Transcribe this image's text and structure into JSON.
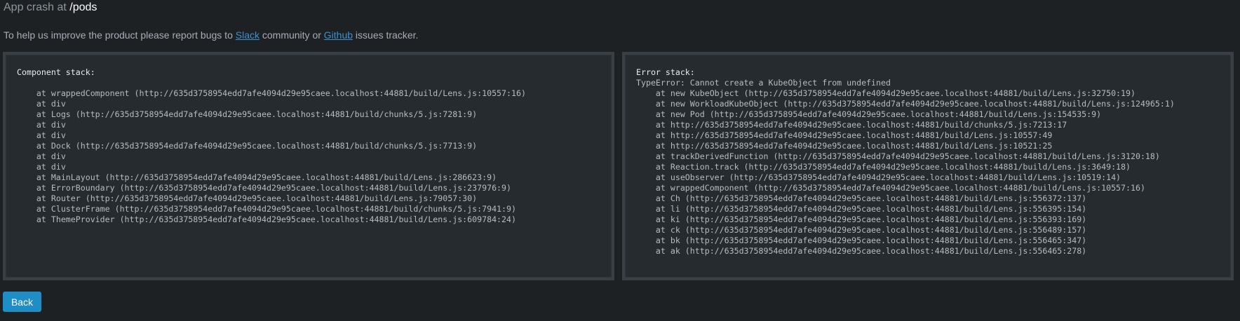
{
  "header": {
    "prefix": "App crash at ",
    "path": "/pods"
  },
  "intro": {
    "before": "To help us improve the product please report bugs to ",
    "slack_label": "Slack",
    "middle": " community or ",
    "github_label": "Github",
    "after": " issues tracker."
  },
  "component_stack": {
    "title": "Component stack:",
    "text": "\n    at wrappedComponent (http://635d3758954edd7afe4094d29e95caee.localhost:44881/build/Lens.js:10557:16)\n    at div\n    at Logs (http://635d3758954edd7afe4094d29e95caee.localhost:44881/build/chunks/5.js:7281:9)\n    at div\n    at div\n    at Dock (http://635d3758954edd7afe4094d29e95caee.localhost:44881/build/chunks/5.js:7713:9)\n    at div\n    at div\n    at MainLayout (http://635d3758954edd7afe4094d29e95caee.localhost:44881/build/Lens.js:286623:9)\n    at ErrorBoundary (http://635d3758954edd7afe4094d29e95caee.localhost:44881/build/Lens.js:237976:9)\n    at Router (http://635d3758954edd7afe4094d29e95caee.localhost:44881/build/Lens.js:79057:30)\n    at ClusterFrame (http://635d3758954edd7afe4094d29e95caee.localhost:44881/build/chunks/5.js:7941:9)\n    at ThemeProvider (http://635d3758954edd7afe4094d29e95caee.localhost:44881/build/Lens.js:609784:24)"
  },
  "error_stack": {
    "title": "Error stack:",
    "text": "TypeError: Cannot create a KubeObject from undefined\n    at new KubeObject (http://635d3758954edd7afe4094d29e95caee.localhost:44881/build/Lens.js:32750:19)\n    at new WorkloadKubeObject (http://635d3758954edd7afe4094d29e95caee.localhost:44881/build/Lens.js:124965:1)\n    at new Pod (http://635d3758954edd7afe4094d29e95caee.localhost:44881/build/Lens.js:154535:9)\n    at http://635d3758954edd7afe4094d29e95caee.localhost:44881/build/chunks/5.js:7213:17\n    at http://635d3758954edd7afe4094d29e95caee.localhost:44881/build/Lens.js:10557:49\n    at http://635d3758954edd7afe4094d29e95caee.localhost:44881/build/Lens.js:10521:25\n    at trackDerivedFunction (http://635d3758954edd7afe4094d29e95caee.localhost:44881/build/Lens.js:3120:18)\n    at Reaction.track (http://635d3758954edd7afe4094d29e95caee.localhost:44881/build/Lens.js:3649:18)\n    at useObserver (http://635d3758954edd7afe4094d29e95caee.localhost:44881/build/Lens.js:10519:14)\n    at wrappedComponent (http://635d3758954edd7afe4094d29e95caee.localhost:44881/build/Lens.js:10557:16)\n    at Ch (http://635d3758954edd7afe4094d29e95caee.localhost:44881/build/Lens.js:556372:137)\n    at li (http://635d3758954edd7afe4094d29e95caee.localhost:44881/build/Lens.js:556395:154)\n    at ki (http://635d3758954edd7afe4094d29e95caee.localhost:44881/build/Lens.js:556393:169)\n    at ck (http://635d3758954edd7afe4094d29e95caee.localhost:44881/build/Lens.js:556489:157)\n    at bk (http://635d3758954edd7afe4094d29e95caee.localhost:44881/build/Lens.js:556465:347)\n    at ak (http://635d3758954edd7afe4094d29e95caee.localhost:44881/build/Lens.js:556465:278)"
  },
  "actions": {
    "back_label": "Back"
  },
  "colors": {
    "background": "#1e2124",
    "panel": "#262b2f",
    "panel_border": "#393f45",
    "link": "#3d90ce",
    "button": "#1f8ec6"
  }
}
